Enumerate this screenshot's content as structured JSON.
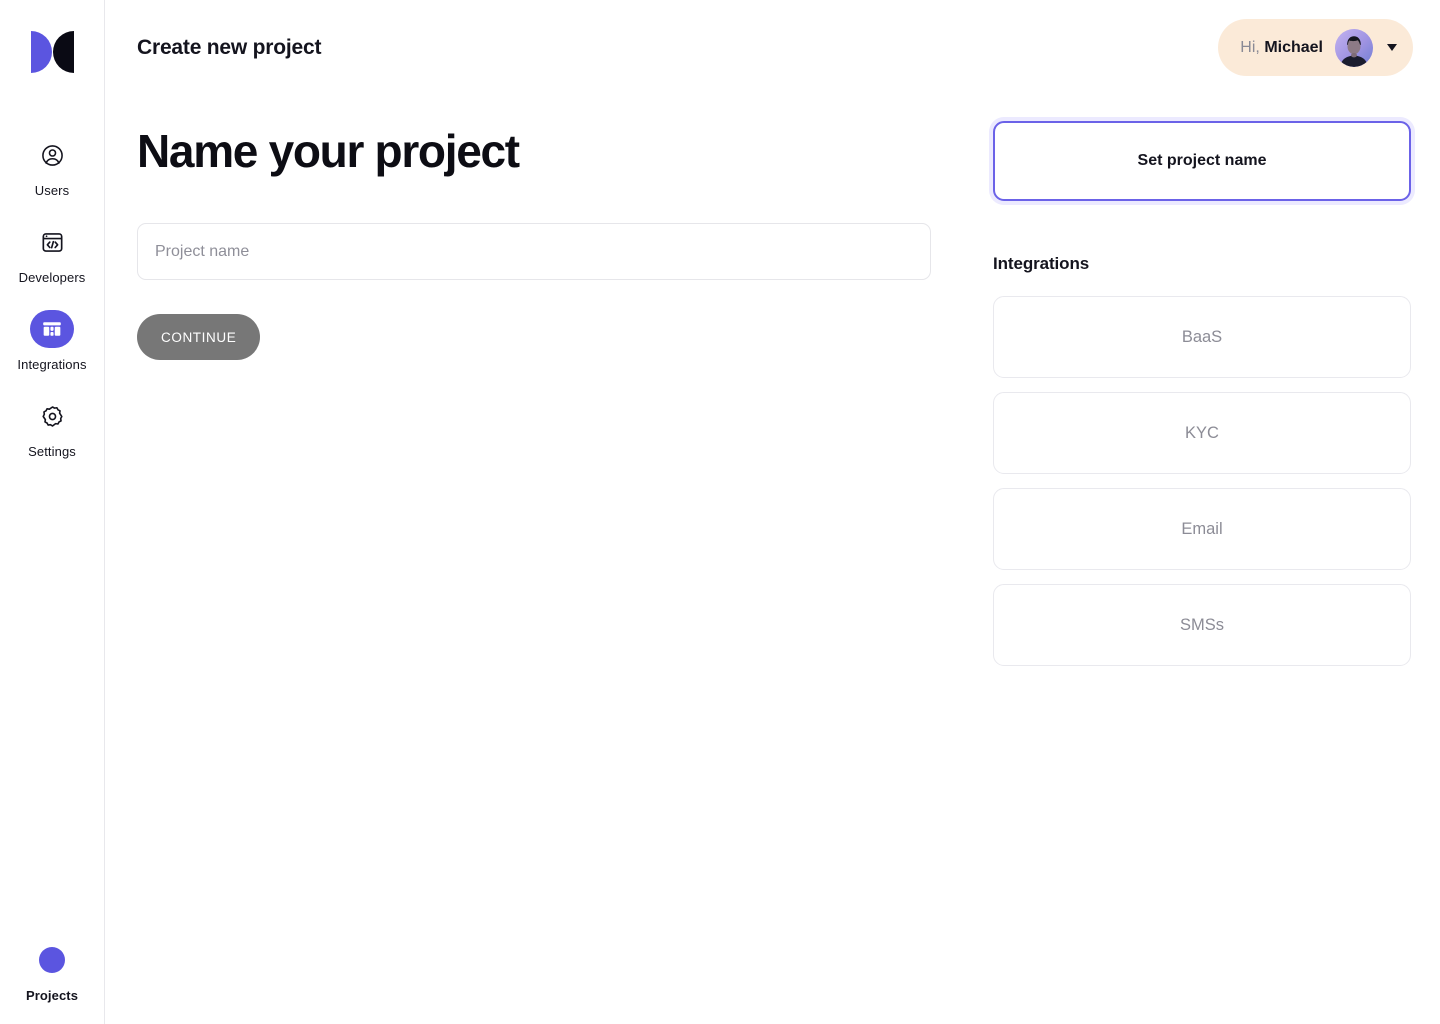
{
  "brand": {
    "logo_name": "logo-split-circles",
    "accent_color": "#5b55e0",
    "dark_color": "#0a0a14"
  },
  "sidebar": {
    "items": [
      {
        "label": "Users",
        "icon": "user-circle-icon",
        "active": false
      },
      {
        "label": "Developers",
        "icon": "code-window-icon",
        "active": false
      },
      {
        "label": "Integrations",
        "icon": "store-grid-icon",
        "active": true
      },
      {
        "label": "Settings",
        "icon": "gear-icon",
        "active": false
      }
    ],
    "bottom": {
      "label": "Projects",
      "icon": "project-dot-icon"
    }
  },
  "header": {
    "title": "Create new project",
    "profile": {
      "greeting": "Hi,",
      "name": "Michael",
      "avatar_alt": "user-avatar",
      "caret": "chevron-down-icon",
      "pill_color": "#fbead8"
    }
  },
  "main": {
    "heading": "Name your project",
    "project_name_value": "",
    "project_name_placeholder": "Project name",
    "continue_label": "CONTINUE",
    "continue_disabled": true
  },
  "steps": {
    "current": "Set project name",
    "border_color": "#6b62e8"
  },
  "integrations": {
    "heading": "Integrations",
    "items": [
      {
        "label": "BaaS"
      },
      {
        "label": "KYC"
      },
      {
        "label": "Email"
      },
      {
        "label": "SMSs"
      }
    ]
  }
}
